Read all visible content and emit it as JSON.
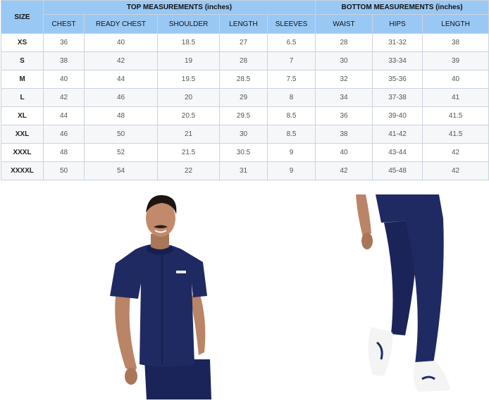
{
  "table": {
    "size_header": "SIZE",
    "top_header": "TOP MEASUREMENTS (inches)",
    "bottom_header": "BOTTOM MEASUREMENTS (inches)",
    "top_columns": [
      "CHEST",
      "READY CHEST",
      "SHOULDER",
      "LENGTH",
      "SLEEVES"
    ],
    "bottom_columns": [
      "WAIST",
      "HIPS",
      "LENGTH"
    ],
    "rows": [
      {
        "size": "XS",
        "values": [
          "36",
          "40",
          "18.5",
          "27",
          "6.5",
          "28",
          "31-32",
          "38"
        ]
      },
      {
        "size": "S",
        "values": [
          "38",
          "42",
          "19",
          "28",
          "7",
          "30",
          "33-34",
          "39"
        ]
      },
      {
        "size": "M",
        "values": [
          "40",
          "44",
          "19.5",
          "28.5",
          "7.5",
          "32",
          "35-36",
          "40"
        ]
      },
      {
        "size": "L",
        "values": [
          "42",
          "46",
          "20",
          "29",
          "8",
          "34",
          "37-38",
          "41"
        ]
      },
      {
        "size": "XL",
        "values": [
          "44",
          "48",
          "20.5",
          "29.5",
          "8.5",
          "36",
          "39-40",
          "41.5"
        ]
      },
      {
        "size": "XXL",
        "values": [
          "46",
          "50",
          "21",
          "30",
          "8.5",
          "38",
          "41-42",
          "41.5"
        ]
      },
      {
        "size": "XXXL",
        "values": [
          "48",
          "52",
          "21.5",
          "30.5",
          "9",
          "40",
          "43-44",
          "42"
        ]
      },
      {
        "size": "XXXXL",
        "values": [
          "50",
          "54",
          "22",
          "31",
          "9",
          "42",
          "45-48",
          "42"
        ]
      }
    ]
  },
  "colors": {
    "header_bg": "#9ac8f4",
    "scrub_navy": "#1f2a63",
    "skin": "#b98566"
  }
}
